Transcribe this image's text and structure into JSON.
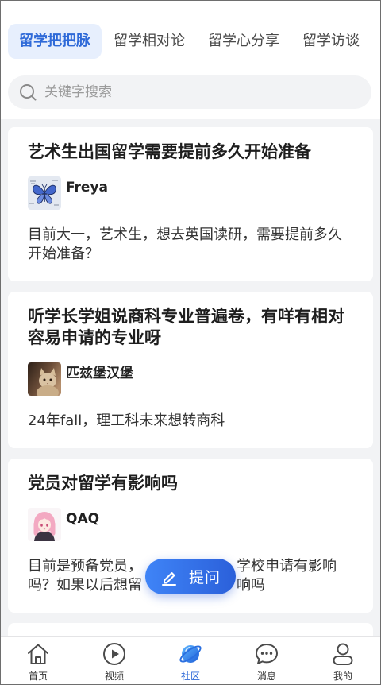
{
  "colors": {
    "accent": "#2f6ad8",
    "tab_active_bg": "#e7effd",
    "page_bg": "#f2f3f5",
    "fab_gradient_start": "#3f84f7",
    "fab_gradient_end": "#2b60da"
  },
  "header": {
    "tabs": [
      {
        "label": "留学把把脉",
        "active": true
      },
      {
        "label": "留学相对论",
        "active": false
      },
      {
        "label": "留学心分享",
        "active": false
      },
      {
        "label": "留学访谈",
        "active": false
      }
    ],
    "search": {
      "placeholder": "关键字搜索",
      "icon": "search-icon"
    }
  },
  "feed": {
    "posts": [
      {
        "title": "艺术生出国留学需要提前多久开始准备",
        "author": "Freya",
        "avatar_image": "butterfly-image",
        "body": "目前大一，艺术生，想去英国读研，需要提前多久开始准备？"
      },
      {
        "title": "听学长学姐说商科专业普遍卷，有咩有相对容易申请的专业呀",
        "author": "匹兹堡汉堡",
        "avatar_image": "cat-photo",
        "body": "24年fall，理工科未来想转商科"
      },
      {
        "title": "党员对留学有影响吗",
        "author": "QAQ",
        "avatar_image": "anime-girl-image",
        "body_lines": [
          [
            "目前是预备党员，",
            "学校申请有影响"
          ],
          [
            "吗？如果以后想留",
            "响吗"
          ]
        ]
      }
    ]
  },
  "fab": {
    "label": "提问",
    "icon": "edit-icon"
  },
  "tabbar": {
    "items": [
      {
        "label": "首页",
        "icon": "home-icon",
        "active": false
      },
      {
        "label": "视频",
        "icon": "video-play-icon",
        "active": false
      },
      {
        "label": "社区",
        "icon": "planet-icon",
        "active": true
      },
      {
        "label": "消息",
        "icon": "message-icon",
        "active": false
      },
      {
        "label": "我的",
        "icon": "profile-icon",
        "active": false
      }
    ]
  }
}
